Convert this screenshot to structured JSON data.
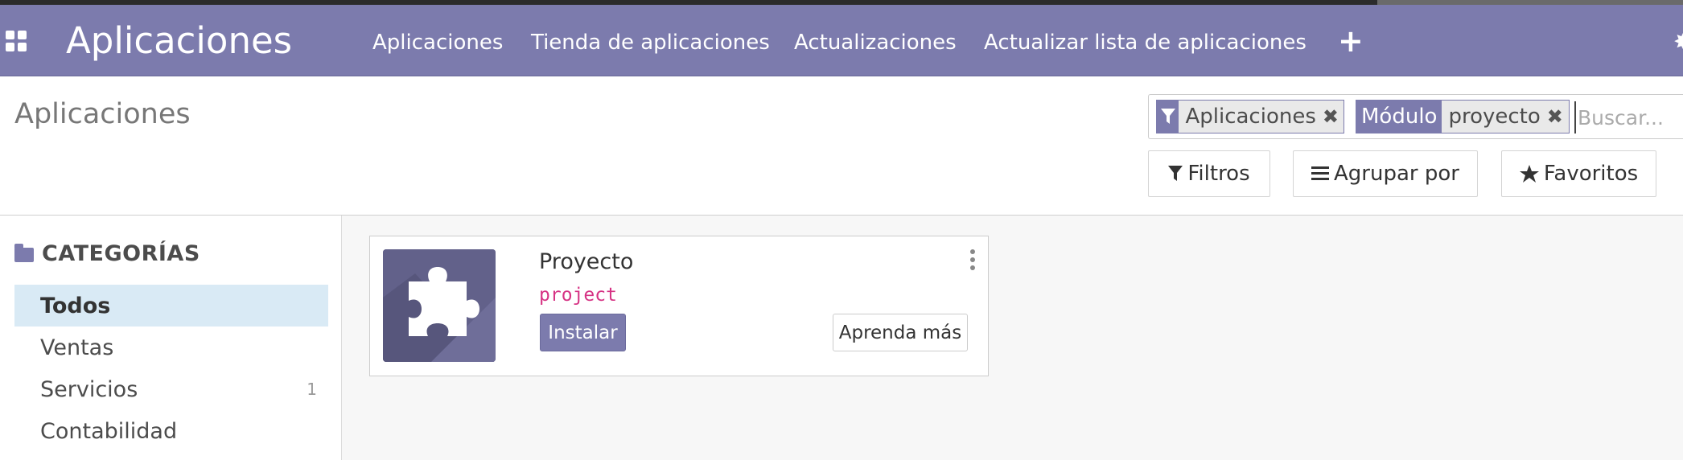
{
  "navbar": {
    "brand": "Aplicaciones",
    "menu": [
      {
        "label": "Aplicaciones"
      },
      {
        "label": "Tienda de aplicaciones"
      },
      {
        "label": "Actualizaciones"
      },
      {
        "label": "Actualizar lista de aplicaciones"
      }
    ],
    "plus_label": "+",
    "right_icon": "bug-icon",
    "color": "#7c7bad"
  },
  "control_panel": {
    "title": "Aplicaciones",
    "search": {
      "facets": [
        {
          "icon": "filter-icon",
          "value": "Aplicaciones"
        },
        {
          "label": "Módulo",
          "value": "proyecto"
        }
      ],
      "placeholder": "Buscar..."
    },
    "buttons": {
      "filters": "Filtros",
      "group_by": "Agrupar por",
      "favorites": "Favoritos"
    }
  },
  "sidebar": {
    "header": "CATEGORÍAS",
    "items": [
      {
        "label": "Todos",
        "active": true,
        "count": ""
      },
      {
        "label": "Ventas",
        "active": false,
        "count": ""
      },
      {
        "label": "Servicios",
        "active": false,
        "count": "1"
      },
      {
        "label": "Contabilidad",
        "active": false,
        "count": ""
      }
    ]
  },
  "cards": [
    {
      "name": "Proyecto",
      "technical_name": "project",
      "install_label": "Instalar",
      "learn_label": "Aprenda más",
      "icon": "puzzle-icon"
    }
  ],
  "colors": {
    "accent": "#7c7bad",
    "active_bg": "#d9eaf5",
    "tech_name": "#d63384"
  }
}
